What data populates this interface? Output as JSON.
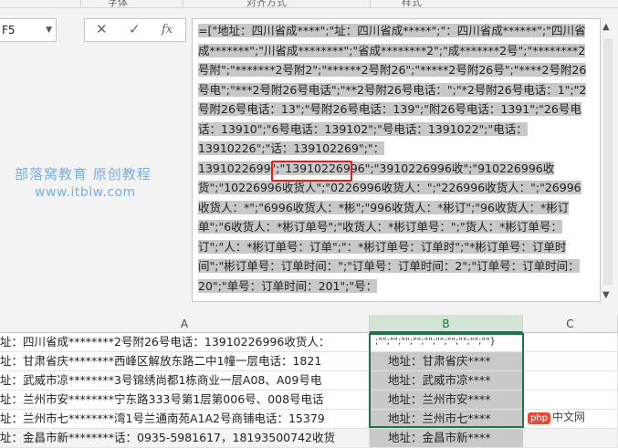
{
  "ribbon": {
    "labels": [
      "",
      "字体",
      "对齐方式",
      "样式"
    ]
  },
  "namebox": {
    "value": "F5"
  },
  "fx_buttons": {
    "cancel": "✕",
    "enter": "✓",
    "fx": "fx"
  },
  "formula_bar": {
    "text": "=[\"地址：四川省成****\";\"址：四川省成*****\";\"：四川省成******\";\"四川省成*******\";\"川省成********\";\"省成********2\";\"成*******2号\";\"********2号附\";\"*******2号附2\";\"******2号附26\";\"*****2号附26号\";\"****2号附26号电\";\"***2号附26号电话\";\"**2号附26号电话：\";\"*2号附26号电话：1\";\"2号附26号电话：13\";\"号附26号电话：139\";\"附26号电话：1391\";\"26号电话：13910\";\"6号电话：139102\";\"号电话：1391022\";\"电话：13910226\";\"话：139102269\";\"：1391022699\";\"13910226996\";\"3910226996收\";\"910226996收货\";\"10226996收货人\";\"0226996收货人：\";\"226996收货人：\";\"26996收货人：*\";\"6996收货人：*彬\";\"996收货人：*彬订\";\"96收货人：*彬订单\";\"6收货人：*彬订单号\";\"收货人：*彬订单号：\";\"货人：*彬订单号：订\";\"人：*彬订单号：订单\";\"：*彬订单号：订单时\";\"*彬订单号：订单时间\";\"彬订单号：订单时间：\";\"订单号：订单时间：2\";\"订单号：订单时间：20\";\"单号：订单时间：201\";\"号：",
    "highlighted_value": "\"13910226996\""
  },
  "watermark": {
    "line1": "部落窝教育  原创教程",
    "line2": "www.itblw.com"
  },
  "columns": [
    "A",
    "B",
    "C"
  ],
  "rows": [
    {
      "a": "址：四川省成********2号附26号电话：13910226996收货人：",
      "b": ";\"\";\"\";\"\";\"\";\"\";\"\";\"\";\"\";\"\";\"\"}"
    },
    {
      "a": "址：甘肃省庆********西峰区解放东路二中1幢一层电话：1821",
      "b": "地址：甘肃省庆****"
    },
    {
      "a": "址：武威市凉********3号锦绣尚都1栋商业一层A08、A09号电",
      "b": "地址：武威市凉****"
    },
    {
      "a": "址：兰州市安********宁东路333号第1层第006号、008号电话",
      "b": "地址：兰州市安****"
    },
    {
      "a": "址：兰州市七********湾1号兰通南苑A1A2号商铺电话：15379",
      "b": "地址：兰州市七****"
    },
    {
      "a": "址：金昌市新********话：0935-5981617，18193500742收货",
      "b": "地址：金昌市新****"
    }
  ],
  "logo": {
    "badge": "php",
    "text": "中文网"
  },
  "colors": {
    "selection_green": "#217346",
    "highlight_red": "#e02020",
    "watermark_blue": "#7aaee0",
    "selected_fill": "#c9c9c9"
  }
}
